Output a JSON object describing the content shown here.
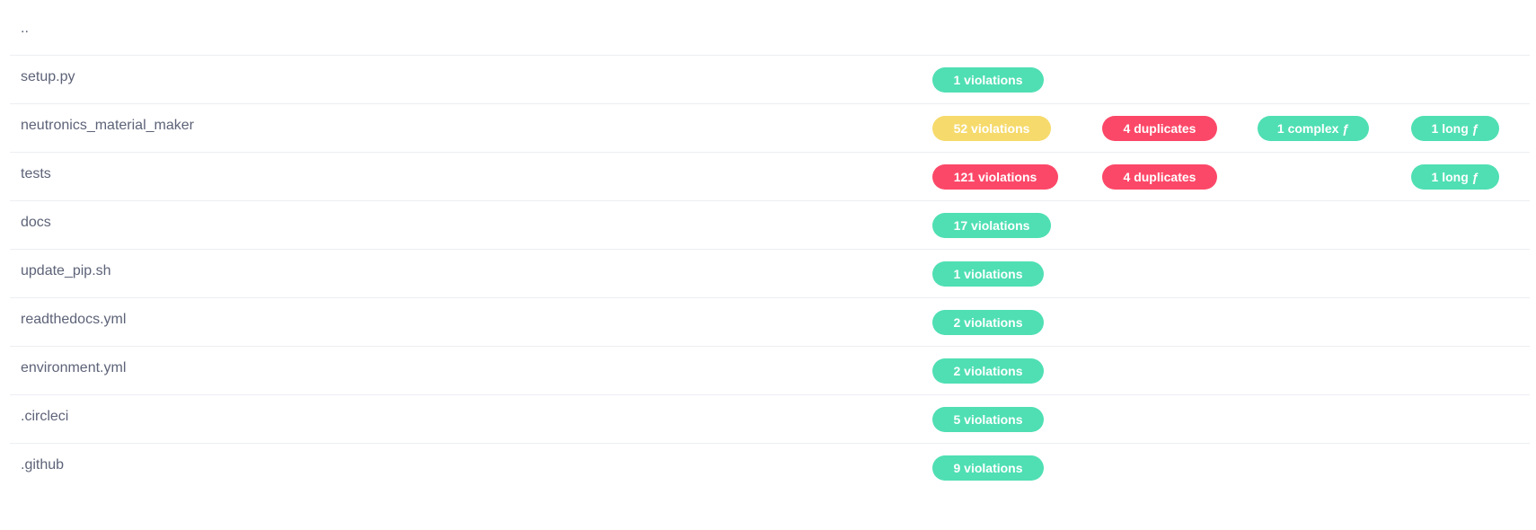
{
  "colors": {
    "good": "#4fdfb3",
    "warning": "#f6da6b",
    "bad": "#fc4868"
  },
  "rows": [
    {
      "name": ".."
    },
    {
      "name": "setup.py",
      "violations": "1 violations"
    },
    {
      "name": "neutronics_material_maker",
      "violations": "52 violations",
      "duplicates": "4 duplicates",
      "complex": "1 complex ƒ",
      "long": "1 long ƒ"
    },
    {
      "name": "tests",
      "violations": "121 violations",
      "duplicates": "4 duplicates",
      "long": "1 long ƒ"
    },
    {
      "name": "docs",
      "violations": "17 violations"
    },
    {
      "name": "update_pip.sh",
      "violations": "1 violations"
    },
    {
      "name": "readthedocs.yml",
      "violations": "2 violations"
    },
    {
      "name": "environment.yml",
      "violations": "2 violations"
    },
    {
      "name": ".circleci",
      "violations": "5 violations"
    },
    {
      "name": ".github",
      "violations": "9 violations"
    }
  ]
}
